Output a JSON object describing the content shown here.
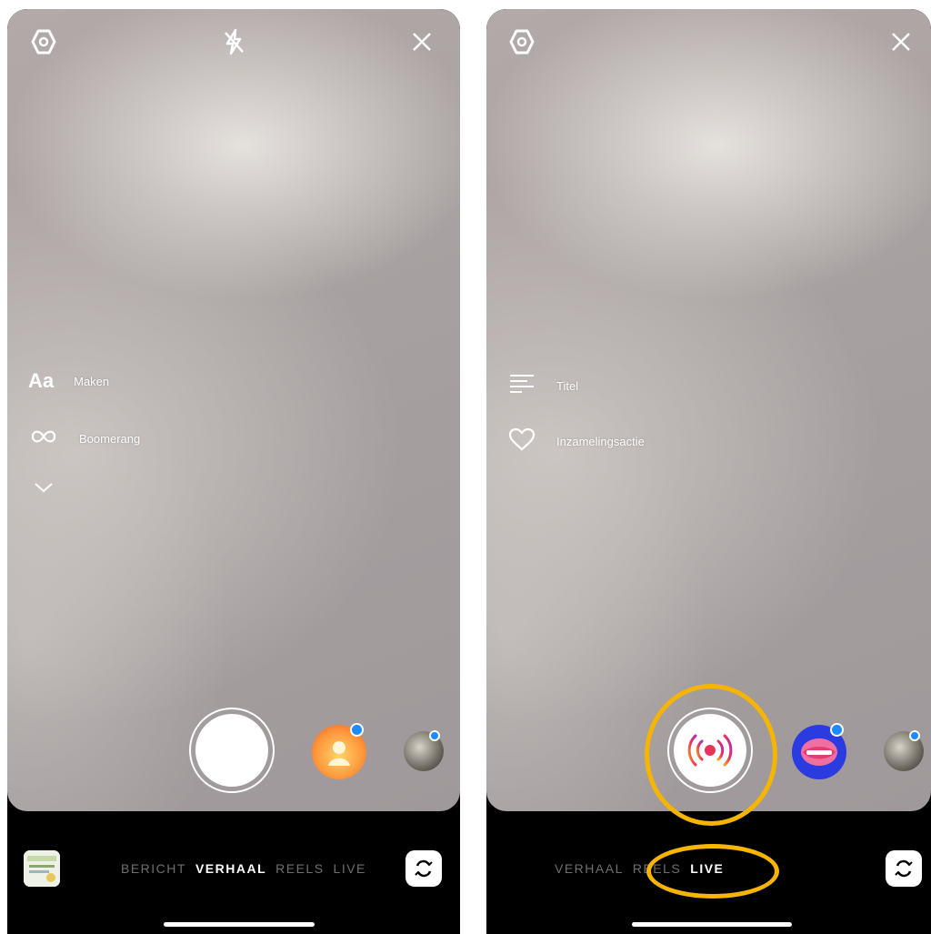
{
  "left_screen": {
    "side_tools": [
      {
        "icon": "text-aa-icon",
        "glyph": "Aa",
        "label": "Maken"
      },
      {
        "icon": "infinity-icon",
        "label": "Boomerang"
      }
    ],
    "modes": [
      "BERICHT",
      "VERHAAL",
      "REELS",
      "LIVE"
    ],
    "active_mode": "VERHAAL"
  },
  "right_screen": {
    "side_tools": [
      {
        "icon": "lines-icon",
        "label": "Titel"
      },
      {
        "icon": "heart-icon",
        "label": "Inzamelingsactie"
      }
    ],
    "modes": [
      "VERHAAL",
      "REELS",
      "LIVE"
    ],
    "active_mode": "LIVE"
  },
  "colors": {
    "highlight": "#f7b500",
    "badge": "#1a8cff",
    "background": "#000000"
  }
}
